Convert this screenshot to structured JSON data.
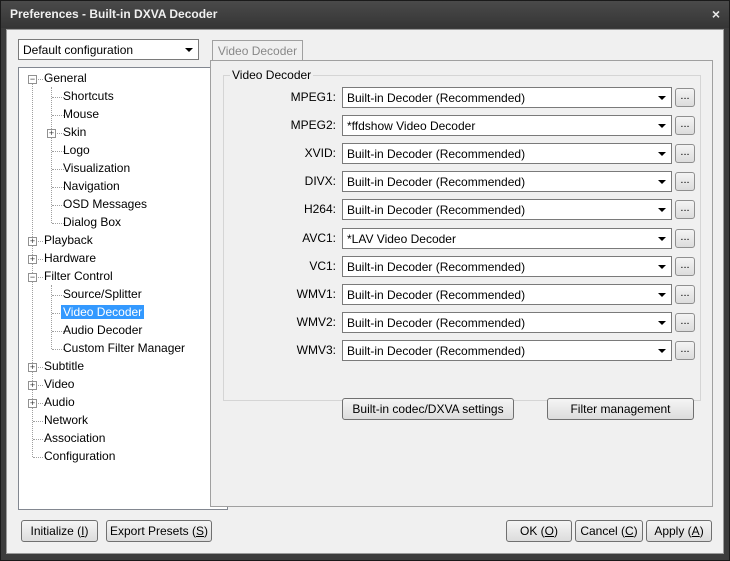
{
  "window": {
    "title": "Preferences - Built-in DXVA Decoder",
    "close_glyph": "×"
  },
  "config_select": {
    "value": "Default configuration"
  },
  "tree": {
    "items": [
      {
        "label": "General",
        "expander": "−"
      },
      {
        "label": "Shortcuts"
      },
      {
        "label": "Mouse"
      },
      {
        "label": "Skin",
        "expander": "+"
      },
      {
        "label": "Logo"
      },
      {
        "label": "Visualization"
      },
      {
        "label": "Navigation"
      },
      {
        "label": "OSD Messages"
      },
      {
        "label": "Dialog Box"
      },
      {
        "label": "Playback",
        "expander": "+"
      },
      {
        "label": "Hardware",
        "expander": "+"
      },
      {
        "label": "Filter Control",
        "expander": "−"
      },
      {
        "label": "Source/Splitter"
      },
      {
        "label": "Video Decoder",
        "selected": true
      },
      {
        "label": "Audio Decoder"
      },
      {
        "label": "Custom Filter Manager"
      },
      {
        "label": "Subtitle",
        "expander": "+"
      },
      {
        "label": "Video",
        "expander": "+"
      },
      {
        "label": "Audio",
        "expander": "+"
      },
      {
        "label": "Network"
      },
      {
        "label": "Association"
      },
      {
        "label": "Configuration"
      }
    ]
  },
  "tab": {
    "label": "Video Decoder"
  },
  "group": {
    "title": "Video Decoder"
  },
  "decoders": [
    {
      "label": "MPEG1:",
      "value": "Built-in Decoder (Recommended)"
    },
    {
      "label": "MPEG2:",
      "value": "*ffdshow Video Decoder"
    },
    {
      "label": "XVID:",
      "value": "Built-in Decoder (Recommended)"
    },
    {
      "label": "DIVX:",
      "value": "Built-in Decoder (Recommended)"
    },
    {
      "label": "H264:",
      "value": "Built-in Decoder (Recommended)"
    },
    {
      "label": "AVC1:",
      "value": "*LAV Video Decoder"
    },
    {
      "label": "VC1:",
      "value": "Built-in Decoder (Recommended)"
    },
    {
      "label": "WMV1:",
      "value": "Built-in Decoder (Recommended)"
    },
    {
      "label": "WMV2:",
      "value": "Built-in Decoder (Recommended)"
    },
    {
      "label": "WMV3:",
      "value": "Built-in Decoder (Recommended)"
    }
  ],
  "dots_label": "...",
  "buttons": {
    "codec_settings": "Built-in codec/DXVA settings",
    "filter_management": "Filter management",
    "initialize": {
      "text": "Initialize (",
      "key": "I",
      "end": ")"
    },
    "export_presets": {
      "text": "Export Presets (",
      "key": "S",
      "end": ")"
    },
    "ok": {
      "text": "OK (",
      "key": "O",
      "end": ")"
    },
    "cancel": {
      "text": "Cancel (",
      "key": "C",
      "end": ")"
    },
    "apply": {
      "text": "Apply (",
      "key": "A",
      "end": ")"
    }
  }
}
